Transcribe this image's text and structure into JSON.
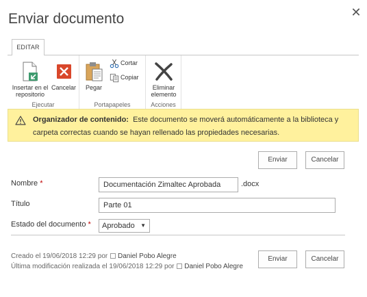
{
  "dialog": {
    "title": "Enviar documento",
    "close_icon": "close-icon"
  },
  "ribbon": {
    "tab_label": "EDITAR",
    "groups": [
      {
        "label": "Ejecutar",
        "commands": [
          {
            "label_line1": "Insertar en el",
            "label_line2": "repositorio",
            "icon": "insert-repository-icon"
          },
          {
            "label_line1": "Cancelar",
            "icon": "cancel-icon",
            "color": "#d9472b"
          }
        ]
      },
      {
        "label": "Portapapeles",
        "commands": [
          {
            "label_line1": "Pegar",
            "icon": "paste-icon"
          },
          {
            "label_line1": "Cortar",
            "icon": "scissors-icon"
          },
          {
            "label_line1": "Copiar",
            "icon": "copy-icon"
          }
        ]
      },
      {
        "label": "Acciones",
        "commands": [
          {
            "label_line1": "Eliminar",
            "label_line2": "elemento",
            "icon": "delete-x-icon"
          }
        ]
      }
    ]
  },
  "warning": {
    "bold": "Organizador de contenido:",
    "text": "Este documento se moverá automáticamente a la biblioteca y carpeta correctas cuando se hayan rellenado las propiedades necesarias.",
    "background": "#fff19d",
    "icon": "warning-triangle-icon"
  },
  "top_buttons": {
    "submit": "Enviar",
    "cancel": "Cancelar"
  },
  "form": {
    "name": {
      "label": "Nombre",
      "required_mark": "*",
      "value": "Documentación Zimaltec Aprobada",
      "extension": ".docx"
    },
    "title": {
      "label": "Título",
      "value": "Parte 01"
    },
    "status": {
      "label": "Estado del documento",
      "required_mark": "*",
      "value": "Aprobado"
    }
  },
  "meta": {
    "created_prefix": "Creado el 19/06/2018 12:29  por",
    "created_user": "Daniel Pobo Alegre",
    "modified_prefix": "Última modificación realizada el 19/06/2018 12:29  por",
    "modified_user": "Daniel Pobo Alegre"
  },
  "bottom_buttons": {
    "submit": "Enviar",
    "cancel": "Cancelar"
  },
  "colors": {
    "required": "#bf0000",
    "accent_cancel": "#d9472b"
  }
}
